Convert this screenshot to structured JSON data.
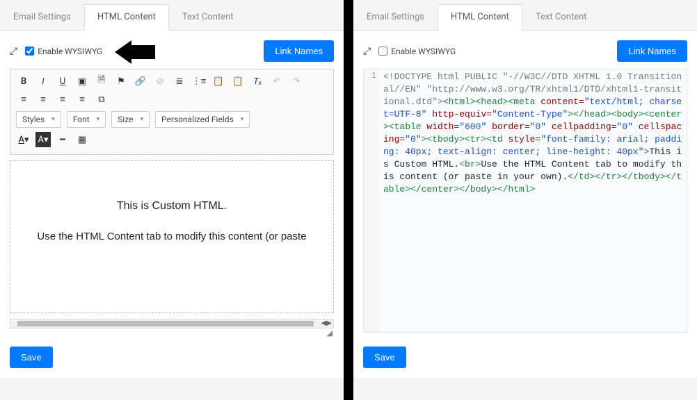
{
  "tabs": {
    "email": "Email Settings",
    "html": "HTML Content",
    "text": "Text Content"
  },
  "controls": {
    "enable_wysiwyg": "Enable WYSIWYG",
    "link_names": "Link Names",
    "save": "Save"
  },
  "toolbar": {
    "styles": "Styles",
    "font": "Font",
    "size": "Size",
    "personalized": "Personalized Fields"
  },
  "editor": {
    "line1": "This is Custom HTML.",
    "line2": "Use the HTML Content tab to modify this content (or paste"
  },
  "code": {
    "gutter": "1",
    "doctype1": "<!DOCTYPE html PUBLIC \"-//W3C//DTD XHTML 1.0 Transitional//EN\" \"http://www.w3.org/TR/xhtml1/DTD/xhtml1-transitional.dtd\">",
    "meta_content": "\"text/html; charset=UTF-8\"",
    "meta_equiv": "\"Content-Type\"",
    "tbl_w": "\"600\"",
    "tbl_b": "\"0\"",
    "tbl_cp": "\"0\"",
    "tbl_cs": "\"0\"",
    "td_style": "\"font-family: arial; padding: 40px; text-align: center; line-height: 40px\"",
    "body1": "This is Custom HTML.",
    "body2": "Use the HTML Content tab to modify this content (or paste in your own)."
  }
}
